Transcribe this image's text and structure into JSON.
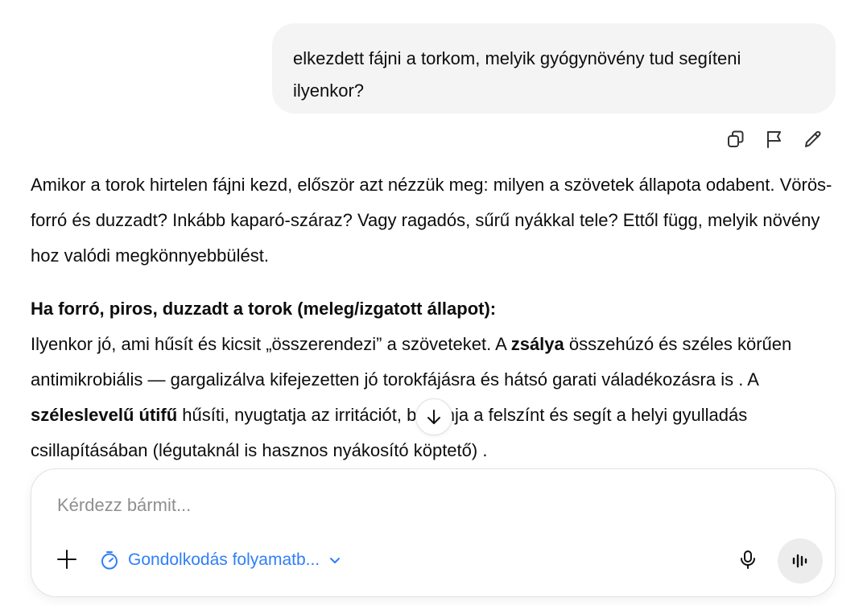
{
  "user_message": {
    "text": "elkezdett fájni a torkom, melyik gyógynövény tud segíteni ilyenkor?"
  },
  "message_actions": {
    "icons": [
      "copy-icon",
      "flag-icon",
      "edit-pencil-icon"
    ]
  },
  "assistant_message": {
    "paragraph1": "Amikor a torok hirtelen fájni kezd, először azt nézzük meg: milyen a szövetek állapota odabent. Vörös-forró és duzzadt? Inkább kaparó-száraz? Vagy ragadós, sűrű nyákkal tele? Ettől függ, melyik növény hoz valódi megkönnyebbülést.",
    "heading": "Ha forró, piros, duzzadt a torok (meleg/izgatott állapot):",
    "p2": {
      "part1": "Ilyenkor jó, ami hűsít és kicsit „összerendezi” a szöveteket. A ",
      "bold1": "zsálya",
      "part2": " összehúzó és széles körűen antimikrobiális — gargalizálva kifejezetten jó torokfájásra és hátsó garati váladékozásra is . A ",
      "bold2": "széleslevelű útifű",
      "part3": " hűsíti, nyugtatja az irritációt, bevonja a felszínt és segít a helyi gyulladás csillapításában (légutaknál is hasznos nyákosító köptető) ."
    }
  },
  "scroll_button": {
    "icon": "arrow-down-icon"
  },
  "composer": {
    "placeholder": "Kérdezz bármit...",
    "value": "",
    "mode_label": "Gondolkodás folyamatb...",
    "mode_icon": "timer-icon",
    "colors": {
      "mode_accent": "#2f7ff7",
      "voice_bg": "#ececec"
    }
  }
}
